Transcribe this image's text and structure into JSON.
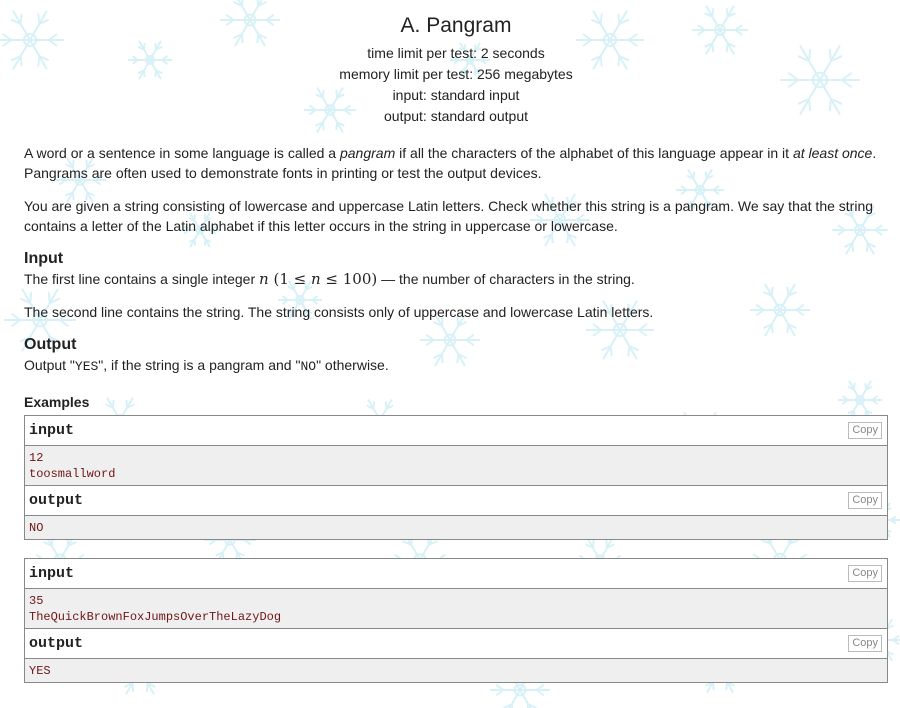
{
  "problem": {
    "title": "A. Pangram",
    "time_limit": "time limit per test: 2 seconds",
    "memory_limit": "memory limit per test: 256 megabytes",
    "input_file": "input: standard input",
    "output_file": "output: standard output"
  },
  "statement": {
    "p1_a": "A word or a sentence in some language is called a ",
    "p1_em1": "pangram",
    "p1_b": " if all the characters of the alphabet of this language appear in it ",
    "p1_em2": "at least once",
    "p1_c": ". Pangrams are often used to demonstrate fonts in printing or test the output devices.",
    "p2": "You are given a string consisting of lowercase and uppercase Latin letters. Check whether this string is a pangram. We say that the string contains a letter of the Latin alphabet if this letter occurs in the string in uppercase or lowercase."
  },
  "input_section": {
    "title": "Input",
    "line1_a": "The first line contains a single integer ",
    "math_n": "n",
    "math_constraint_open": "(1 ≤ ",
    "math_constraint_close": " ≤ 100)",
    "line1_b": " — the number of characters in the string.",
    "line2": "The second line contains the string. The string consists only of uppercase and lowercase Latin letters."
  },
  "output_section": {
    "title": "Output",
    "text_a": "Output \"",
    "yes": "YES",
    "text_b": "\", if the string is a pangram and \"",
    "no": "NO",
    "text_c": "\" otherwise."
  },
  "examples": {
    "title": "Examples",
    "input_label": "input",
    "output_label": "output",
    "copy_label": "Copy",
    "items": [
      {
        "input": [
          "12",
          "toosmallword"
        ],
        "output": [
          "NO"
        ]
      },
      {
        "input": [
          "35",
          "TheQuickBrownFoxJumpsOverTheLazyDog"
        ],
        "output": [
          "YES"
        ]
      }
    ]
  },
  "colors": {
    "snowflake": "#cfeef6",
    "sample_text": "#6e1515",
    "border": "#888888"
  }
}
